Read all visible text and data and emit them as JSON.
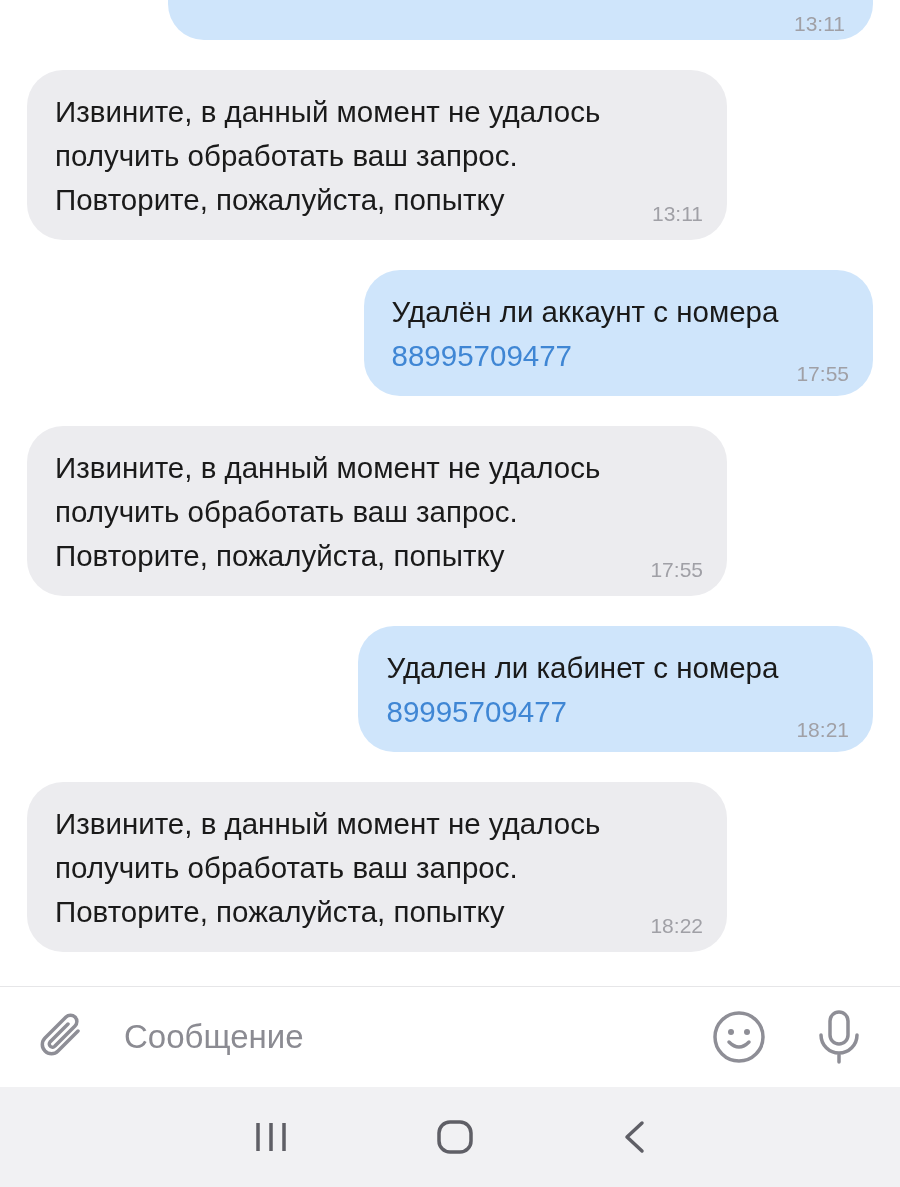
{
  "messages": [
    {
      "kind": "outgoing",
      "time": "13:11",
      "partial": true
    },
    {
      "kind": "incoming",
      "text": "Извините, в данный момент не удалось получить обработать ваш запрос. Повторите, пожалуйста, попытку",
      "time": "13:11"
    },
    {
      "kind": "outgoing",
      "text": "Удалён ли аккаунт с номера",
      "phone": "88995709477",
      "time": "17:55"
    },
    {
      "kind": "incoming",
      "text": "Извините, в данный момент не удалось получить обработать ваш запрос. Повторите, пожалуйста, попытку",
      "time": "17:55"
    },
    {
      "kind": "outgoing",
      "text": "Удален ли кабинет с номера",
      "phone": "89995709477",
      "time": "18:21"
    },
    {
      "kind": "incoming",
      "text": "Извините, в данный момент не удалось получить обработать ваш запрос. Повторите, пожалуйста, попытку",
      "time": "18:22"
    }
  ],
  "composer": {
    "placeholder": "Сообщение"
  }
}
